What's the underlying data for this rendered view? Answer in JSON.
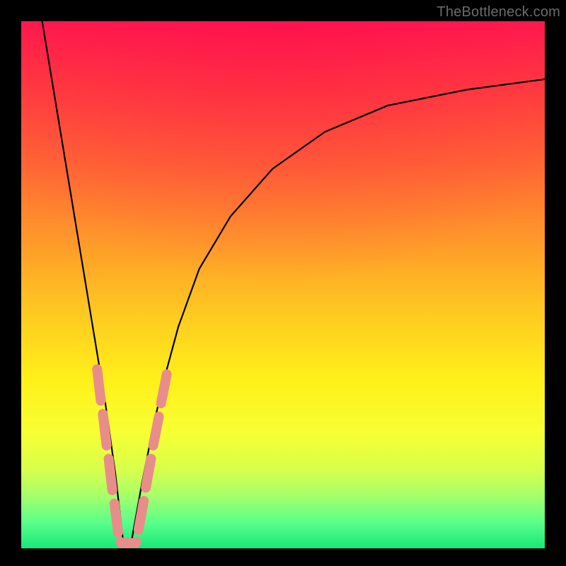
{
  "watermark": "TheBottleneck.com",
  "colors": {
    "curve": "#000000",
    "marker_fill": "#e98d8a",
    "marker_stroke": "#c96f6c",
    "background_black": "#000000"
  },
  "chart_data": {
    "type": "line",
    "title": "",
    "xlabel": "",
    "ylabel": "",
    "xlim": [
      0,
      100
    ],
    "ylim": [
      0,
      100
    ],
    "grid": false,
    "legend": false,
    "note": "",
    "series": [
      {
        "name": "bottleneck-curve",
        "x": [
          4,
          6,
          8,
          10,
          12,
          14,
          16,
          18,
          19.5,
          21,
          23,
          25,
          27,
          30,
          34,
          40,
          48,
          58,
          70,
          85,
          100
        ],
        "y": [
          100,
          88,
          76,
          64,
          52,
          40,
          28,
          14,
          1,
          1,
          12,
          22,
          31,
          42,
          53,
          63,
          72,
          79,
          84,
          87,
          89
        ]
      }
    ],
    "markers": {
      "name": "highlight-segments",
      "segments": [
        {
          "x1": 14.5,
          "y1": 34.0,
          "x2": 15.2,
          "y2": 28.0
        },
        {
          "x1": 15.6,
          "y1": 25.5,
          "x2": 16.3,
          "y2": 19.5
        },
        {
          "x1": 16.7,
          "y1": 17.0,
          "x2": 17.4,
          "y2": 11.0
        },
        {
          "x1": 17.8,
          "y1": 8.5,
          "x2": 18.5,
          "y2": 3.0
        },
        {
          "x1": 19.1,
          "y1": 1.0,
          "x2": 21.8,
          "y2": 1.0
        },
        {
          "x1": 22.4,
          "y1": 3.5,
          "x2": 23.4,
          "y2": 9.0
        },
        {
          "x1": 23.8,
          "y1": 11.5,
          "x2": 24.8,
          "y2": 17.0
        },
        {
          "x1": 25.2,
          "y1": 19.5,
          "x2": 26.3,
          "y2": 25.0
        },
        {
          "x1": 26.7,
          "y1": 27.5,
          "x2": 27.8,
          "y2": 33.0
        }
      ],
      "dots": [
        {
          "x": 19.0,
          "y": 1.2
        },
        {
          "x": 22.0,
          "y": 1.2
        }
      ]
    }
  }
}
